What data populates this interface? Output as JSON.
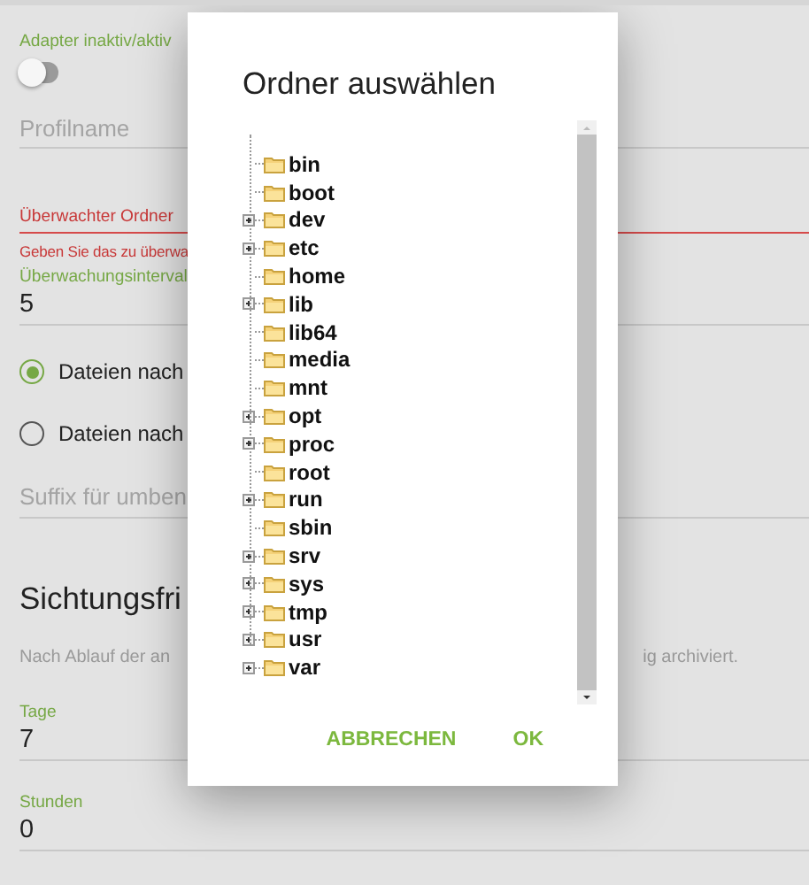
{
  "form": {
    "adapter_toggle": {
      "label": "Adapter inaktiv/aktiv",
      "on": false
    },
    "profile_name": {
      "placeholder": "Profilname"
    },
    "watched_folder": {
      "label": "Überwachter Ordner",
      "hint": "Geben Sie das zu überwa"
    },
    "interval": {
      "label": "Überwachungsinterval",
      "value": "5"
    },
    "radios": [
      {
        "label": "Dateien nach",
        "selected": true
      },
      {
        "label": "Dateien nach",
        "selected": false
      }
    ],
    "suffix": {
      "placeholder": "Suffix für umben"
    },
    "section": {
      "title": "Sichtungsfri",
      "description_start": "Nach Ablauf der an",
      "description_end": "ig archiviert."
    },
    "days": {
      "label": "Tage",
      "value": "7"
    },
    "hours": {
      "label": "Stunden",
      "value": "0"
    }
  },
  "dialog": {
    "title": "Ordner auswählen",
    "tree": [
      {
        "label": "bin",
        "expandable": false
      },
      {
        "label": "boot",
        "expandable": false
      },
      {
        "label": "dev",
        "expandable": true
      },
      {
        "label": "etc",
        "expandable": true
      },
      {
        "label": "home",
        "expandable": false
      },
      {
        "label": "lib",
        "expandable": true
      },
      {
        "label": "lib64",
        "expandable": false
      },
      {
        "label": "media",
        "expandable": false
      },
      {
        "label": "mnt",
        "expandable": false
      },
      {
        "label": "opt",
        "expandable": true
      },
      {
        "label": "proc",
        "expandable": true
      },
      {
        "label": "root",
        "expandable": false
      },
      {
        "label": "run",
        "expandable": true
      },
      {
        "label": "sbin",
        "expandable": false
      },
      {
        "label": "srv",
        "expandable": true
      },
      {
        "label": "sys",
        "expandable": true
      },
      {
        "label": "tmp",
        "expandable": true
      },
      {
        "label": "usr",
        "expandable": true
      },
      {
        "label": "var",
        "expandable": true
      }
    ],
    "buttons": [
      "ABBRECHEN",
      "OK"
    ]
  }
}
